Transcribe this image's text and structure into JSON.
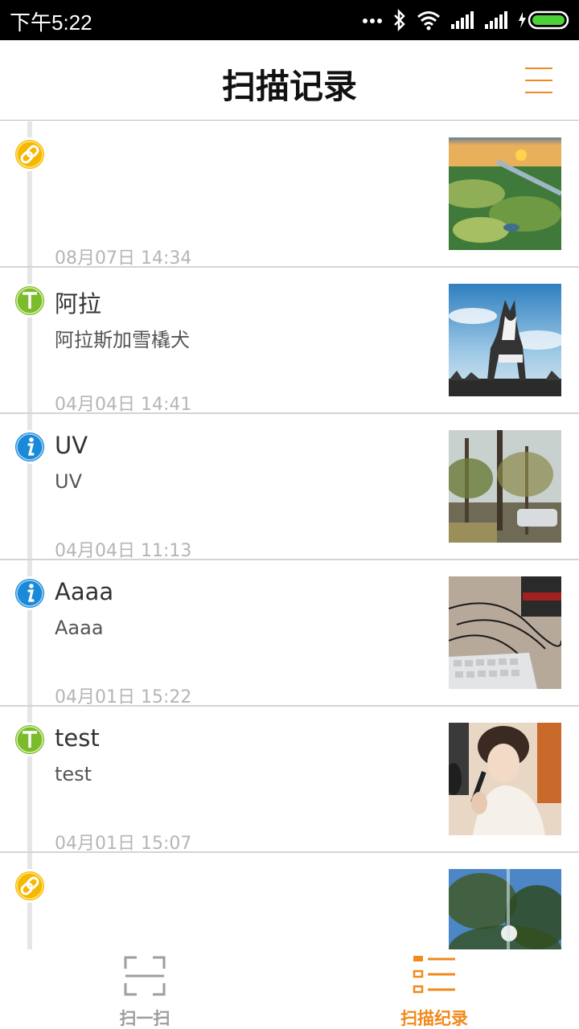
{
  "status_bar": {
    "time": "下午5:22"
  },
  "header": {
    "title": "扫描记录"
  },
  "colors": {
    "accent": "#f08a1c",
    "link_badge": "#f5b800",
    "text_badge": "#7cbb2c",
    "info_badge": "#1a8ad8"
  },
  "records": [
    {
      "type": "link-icon",
      "title": "",
      "subtitle": "",
      "date": "08月07日 14:34",
      "thumbnail": "landscape-photo"
    },
    {
      "type": "text-icon",
      "title": "阿拉",
      "subtitle": "阿拉斯加雪橇犬",
      "date": "04月04日 14:41",
      "thumbnail": "husky-photo"
    },
    {
      "type": "info-icon",
      "title": "UV",
      "subtitle": "UV",
      "date": "04月04日 11:13",
      "thumbnail": "street-trees-photo"
    },
    {
      "type": "info-icon",
      "title": "Aaaa",
      "subtitle": "Aaaa",
      "date": "04月01日 15:22",
      "thumbnail": "keyboard-photo"
    },
    {
      "type": "text-icon",
      "title": "test",
      "subtitle": "test",
      "date": "04月01日 15:07",
      "thumbnail": "person-microphone-photo"
    },
    {
      "type": "link-icon",
      "title": "",
      "subtitle": "",
      "date": "",
      "thumbnail": "tree-sky-photo"
    }
  ],
  "tabs": [
    {
      "label": "扫一扫",
      "icon": "scan-icon",
      "active": false
    },
    {
      "label": "扫描纪录",
      "icon": "list-icon",
      "active": true
    }
  ]
}
